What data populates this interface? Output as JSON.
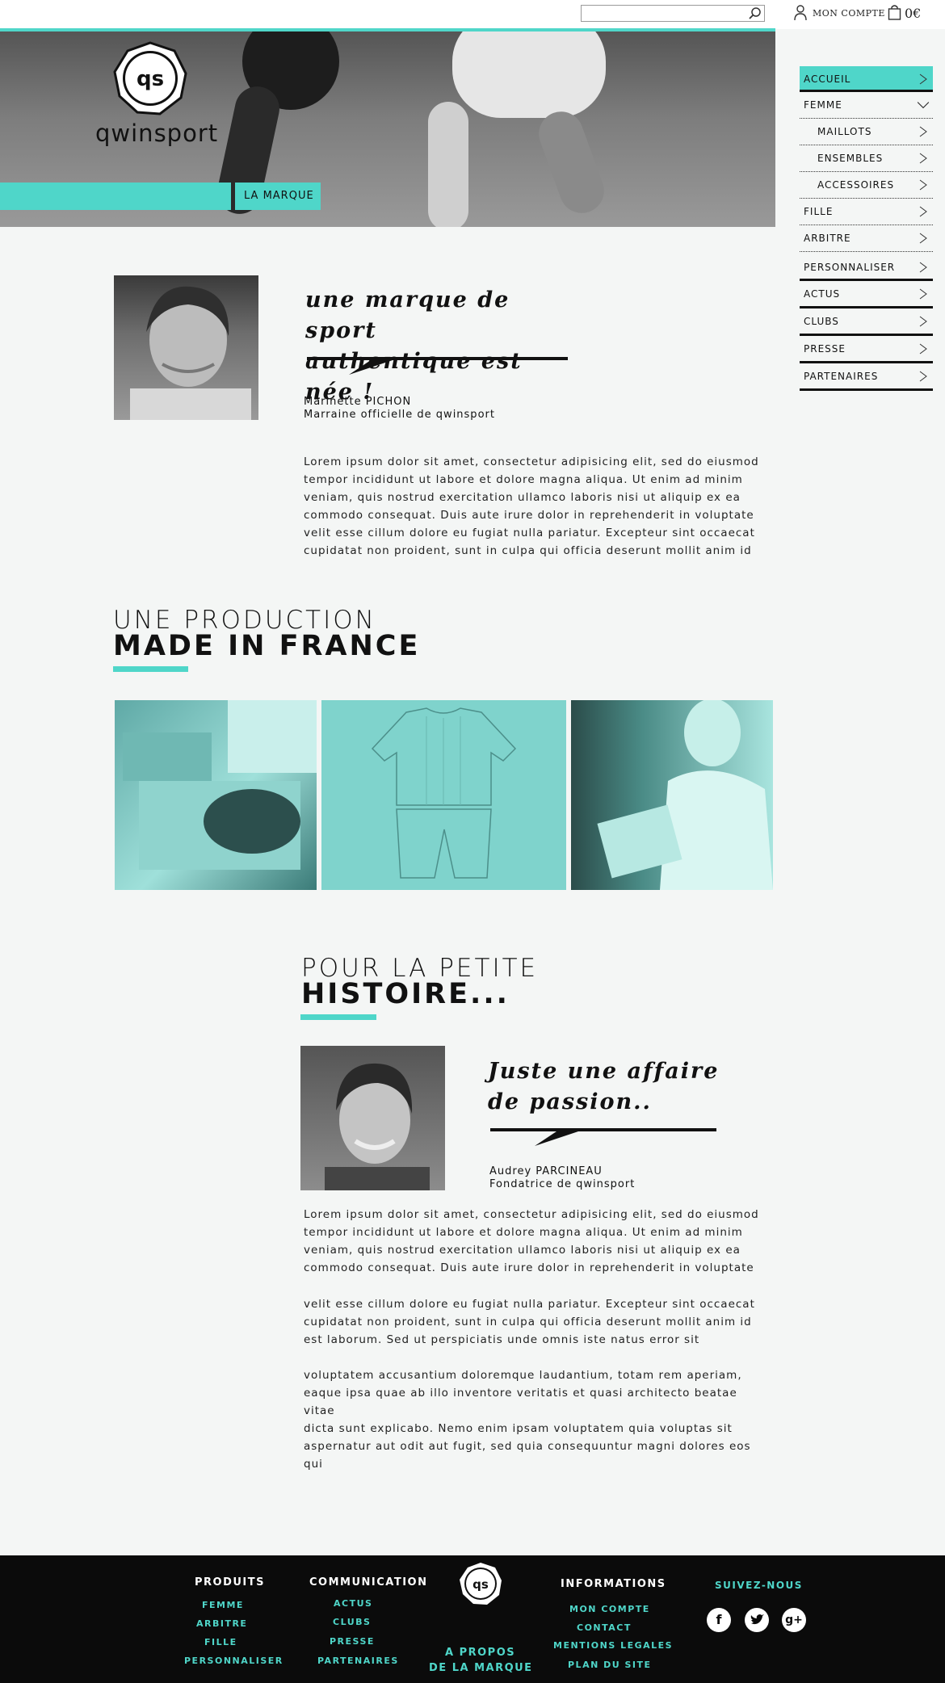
{
  "header": {
    "search_placeholder": "",
    "account_label": "MON COMPTE",
    "cart_total": "0€"
  },
  "hero": {
    "logo_text": "qs",
    "brand_name": "qwinsport",
    "tab_label": "LA MARQUE"
  },
  "sidebar": {
    "items": [
      {
        "label": "ACCUEIL"
      },
      {
        "label": "FEMME"
      },
      {
        "label": "MAILLOTS"
      },
      {
        "label": "ENSEMBLES"
      },
      {
        "label": "ACCESSOIRES"
      },
      {
        "label": "FILLE"
      },
      {
        "label": "ARBITRE"
      },
      {
        "label": "PERSONNALISER"
      },
      {
        "label": "ACTUS"
      },
      {
        "label": "CLUBS"
      },
      {
        "label": "PRESSE"
      },
      {
        "label": "PARTENAIRES"
      }
    ]
  },
  "section1": {
    "quote_line1": "une marque de sport",
    "quote_line2": "authentique est née !",
    "person_name": "Marinette PICHON",
    "person_role": "Marraine officielle de qwinsport",
    "body": "Lorem ipsum dolor sit amet, consectetur adipisicing elit, sed do eiusmod\ntempor incididunt ut labore et dolore magna aliqua. Ut enim ad minim\nveniam, quis nostrud exercitation ullamco laboris nisi ut aliquip ex ea\ncommodo consequat. Duis aute irure dolor in reprehenderit in voluptate\nvelit esse cillum dolore eu fugiat nulla pariatur. Excepteur sint occaecat\ncupidatat non proident, sunt in culpa qui officia deserunt mollit anim id"
  },
  "section2": {
    "heading_light": "UNE PRODUCTION",
    "heading_bold": "MADE IN FRANCE"
  },
  "section3": {
    "heading_light": "POUR LA PETITE",
    "heading_bold": "HISTOIRE...",
    "quote_line1": "Juste une affaire",
    "quote_line2": "de passion..",
    "person_name": "Audrey PARCINEAU",
    "person_role": "Fondatrice de qwinsport",
    "para1": "Lorem ipsum dolor sit amet, consectetur adipisicing elit, sed do eiusmod\ntempor incididunt ut labore et dolore magna aliqua. Ut enim ad minim\nveniam, quis nostrud exercitation ullamco laboris nisi ut aliquip ex ea\ncommodo consequat. Duis aute irure dolor in reprehenderit in voluptate",
    "para2": " velit esse cillum dolore eu fugiat nulla pariatur. Excepteur sint occaecat\ncupidatat non proident, sunt in culpa qui officia deserunt mollit anim id\nest laborum. Sed ut perspiciatis unde omnis iste natus error sit",
    "para3": "voluptatem accusantium doloremque laudantium, totam rem aperiam,\neaque ipsa quae ab illo inventore veritatis et quasi architecto beatae vitae\ndicta sunt explicabo. Nemo enim ipsam voluptatem quia voluptas sit\naspernatur aut odit aut fugit, sed quia consequuntur magni dolores eos qui"
  },
  "footer": {
    "produits": {
      "title": "PRODUITS",
      "links": [
        "FEMME",
        "ARBITRE",
        "FILLE",
        "PERSONNALISER"
      ]
    },
    "communication": {
      "title": "COMMUNICATION",
      "links": [
        "ACTUS",
        "CLUBS",
        "PRESSE",
        "PARTENAIRES"
      ]
    },
    "logo_text": "qs",
    "about_line1": "A PROPOS",
    "about_line2": "DE LA MARQUE",
    "informations": {
      "title": "INFORMATIONS",
      "links": [
        "MON COMPTE",
        "CONTACT",
        "MENTIONS LEGALES",
        "PLAN DU SITE"
      ]
    },
    "social": {
      "title": "SUIVEZ-NOUS",
      "icons": [
        "facebook-icon",
        "twitter-icon",
        "google-plus-icon"
      ]
    }
  },
  "colors": {
    "accent": "#4fd6c9",
    "footer_bg": "#0b0b0b",
    "page_bg": "#f4f6f5"
  }
}
